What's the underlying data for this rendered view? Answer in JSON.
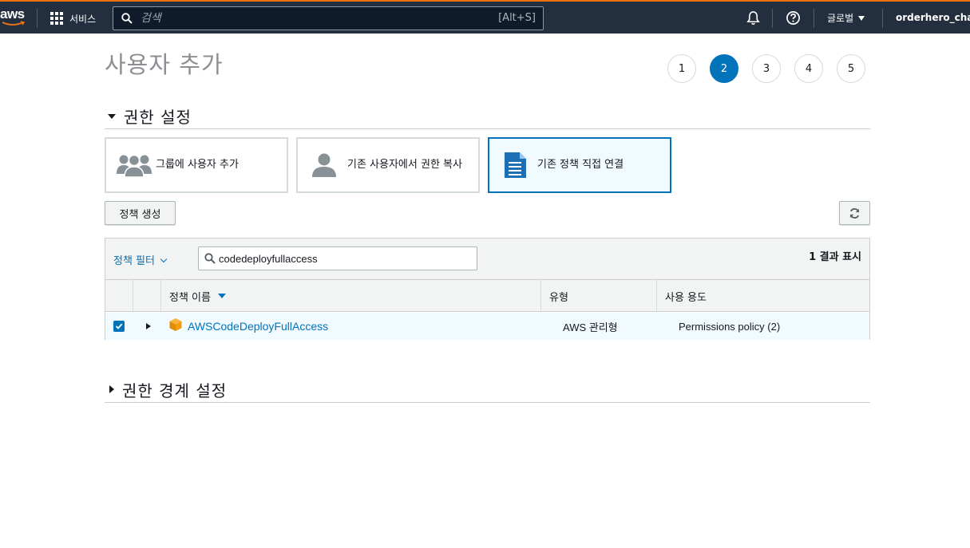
{
  "nav": {
    "logo_text": "aws",
    "services_label": "서비스",
    "search_placeholder": "검색",
    "search_shortcut": "[Alt+S]",
    "region_label": "글로벌",
    "account_label": "orderhero_chatbot"
  },
  "page": {
    "title": "사용자 추가",
    "steps": [
      {
        "label": "1",
        "active": false
      },
      {
        "label": "2",
        "active": true
      },
      {
        "label": "3",
        "active": false
      },
      {
        "label": "4",
        "active": false
      },
      {
        "label": "5",
        "active": false
      }
    ]
  },
  "permissions": {
    "section_title": "권한 설정",
    "options": [
      {
        "label": "그룹에 사용자 추가",
        "icon": "group-icon",
        "selected": false
      },
      {
        "label": "기존 사용자에서 권한 복사",
        "icon": "user-icon",
        "selected": false
      },
      {
        "label": "기존 정책 직접 연결",
        "icon": "document-icon",
        "selected": true
      }
    ],
    "create_policy_label": "정책 생성",
    "refresh_icon": "refresh-icon"
  },
  "policy_table": {
    "filter_label": "정책 필터",
    "search_value": "codedeployfullaccess",
    "result_count": "1 결과 표시",
    "columns": [
      "정책 이름",
      "유형",
      "사용 용도"
    ],
    "rows": [
      {
        "checked": true,
        "name": "AWSCodeDeployFullAccess",
        "type": "AWS 관리형",
        "usage": "Permissions policy (2)"
      }
    ]
  },
  "boundary": {
    "section_title": "권한 경계 설정"
  },
  "colors": {
    "nav_bg": "#232f3e",
    "accent": "#ec7211",
    "link_blue": "#0073bb",
    "selected_bg": "#f1faff"
  }
}
